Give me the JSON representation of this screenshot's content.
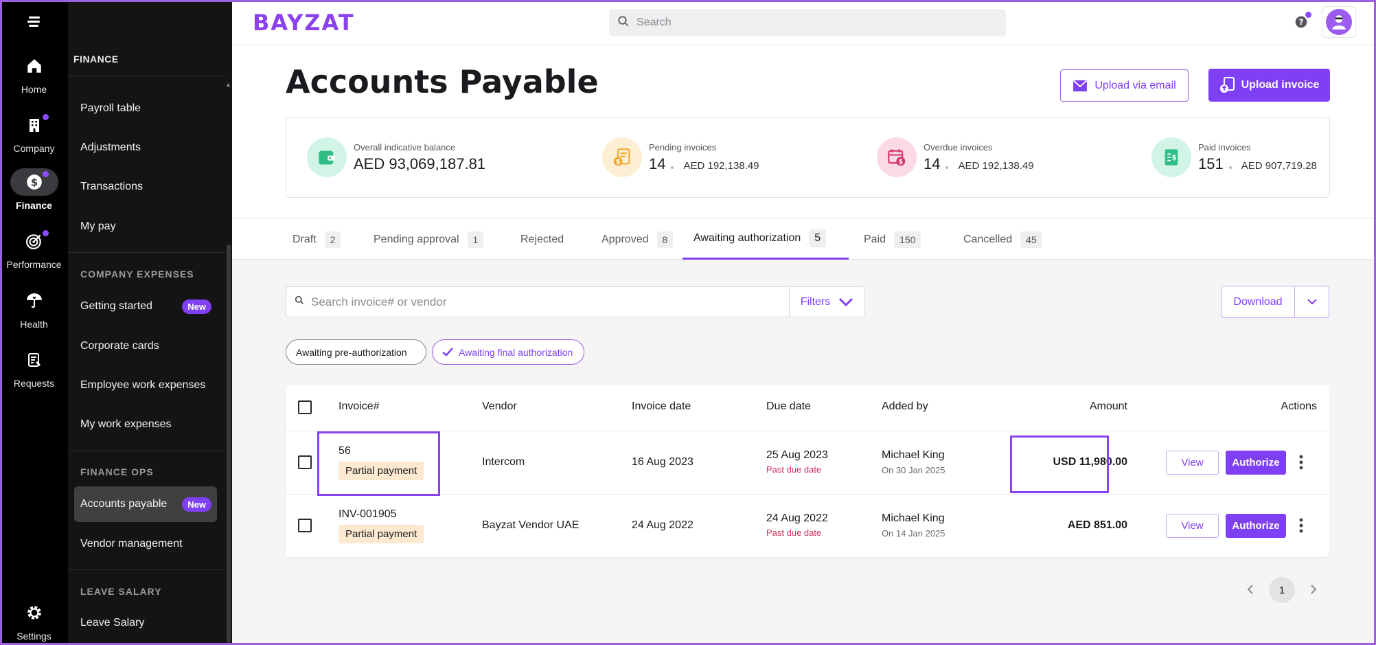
{
  "rail": {
    "items": [
      {
        "label": "Home",
        "icon": "home-icon"
      },
      {
        "label": "Company",
        "icon": "building-icon"
      },
      {
        "label": "Finance",
        "icon": "dollar-coin-icon"
      },
      {
        "label": "Performance",
        "icon": "target-icon"
      },
      {
        "label": "Health",
        "icon": "umbrella-heart-icon"
      },
      {
        "label": "Requests",
        "icon": "clipboard-icon"
      }
    ],
    "settings_label": "Settings"
  },
  "sidebar": {
    "heading": "FINANCE",
    "items_finance": [
      "Payroll table",
      "Adjustments",
      "Transactions",
      "My pay"
    ],
    "section_company": "COMPANY EXPENSES",
    "items_company": [
      {
        "label": "Getting started",
        "badge": "New"
      },
      {
        "label": "Corporate cards",
        "badge": ""
      },
      {
        "label": "Employee work expenses",
        "badge": ""
      },
      {
        "label": "My work expenses",
        "badge": ""
      }
    ],
    "section_ops": "FINANCE OPS",
    "items_ops": [
      {
        "label": "Accounts payable",
        "badge": "New"
      },
      {
        "label": "Vendor management",
        "badge": ""
      }
    ],
    "section_leave": "LEAVE SALARY",
    "items_leave": [
      "Leave Salary"
    ]
  },
  "topbar": {
    "logo": "BAYZAT",
    "search_placeholder": "Search"
  },
  "header": {
    "title": "Accounts Payable",
    "upload_email": "Upload via email",
    "upload_invoice": "Upload invoice"
  },
  "stats": [
    {
      "label": "Overall indicative balance",
      "value": "AED 93,069,187.81",
      "sub": ""
    },
    {
      "label": "Pending invoices",
      "value": "14",
      "sub": "AED 192,138.49"
    },
    {
      "label": "Overdue invoices",
      "value": "14",
      "sub": "AED 192,138.49"
    },
    {
      "label": "Paid invoices",
      "value": "151",
      "sub": "AED 907,719.28"
    }
  ],
  "tabs": [
    {
      "label": "Draft",
      "count": "2"
    },
    {
      "label": "Pending approval",
      "count": "1"
    },
    {
      "label": "Rejected",
      "count": ""
    },
    {
      "label": "Approved",
      "count": "8"
    },
    {
      "label": "Awaiting authorization",
      "count": "5"
    },
    {
      "label": "Paid",
      "count": "150"
    },
    {
      "label": "Cancelled",
      "count": "45"
    }
  ],
  "filters": {
    "search_placeholder": "Search invoice# or vendor",
    "filters_label": "Filters",
    "download_label": "Download",
    "chip_pre": "Awaiting pre-authorization",
    "chip_final": "Awaiting final authorization"
  },
  "table": {
    "headers": {
      "invoice": "Invoice#",
      "vendor": "Vendor",
      "invoice_date": "Invoice date",
      "due_date": "Due date",
      "added_by": "Added by",
      "amount": "Amount",
      "actions": "Actions"
    },
    "rows": [
      {
        "invoice": "56",
        "status": "Partial payment",
        "vendor": "Intercom",
        "invoice_date": "16 Aug 2023",
        "due_date": "25 Aug 2023",
        "due_note": "Past due date",
        "added_by": "Michael King",
        "added_on": "On 30 Jan 2025",
        "amount": "USD 11,980.00",
        "view": "View",
        "authorize": "Authorize"
      },
      {
        "invoice": "INV-001905",
        "status": "Partial payment",
        "vendor": "Bayzat Vendor UAE",
        "invoice_date": "24 Aug 2022",
        "due_date": "24 Aug 2022",
        "due_note": "Past due date",
        "added_by": "Michael King",
        "added_on": "On 14 Jan 2025",
        "amount": "AED 851.00",
        "view": "View",
        "authorize": "Authorize"
      }
    ]
  },
  "pagination": {
    "current": "1"
  },
  "colors": {
    "accent": "#7f3ff2",
    "past_due": "#d32f5b",
    "pill_bg": "#fde9cf"
  }
}
